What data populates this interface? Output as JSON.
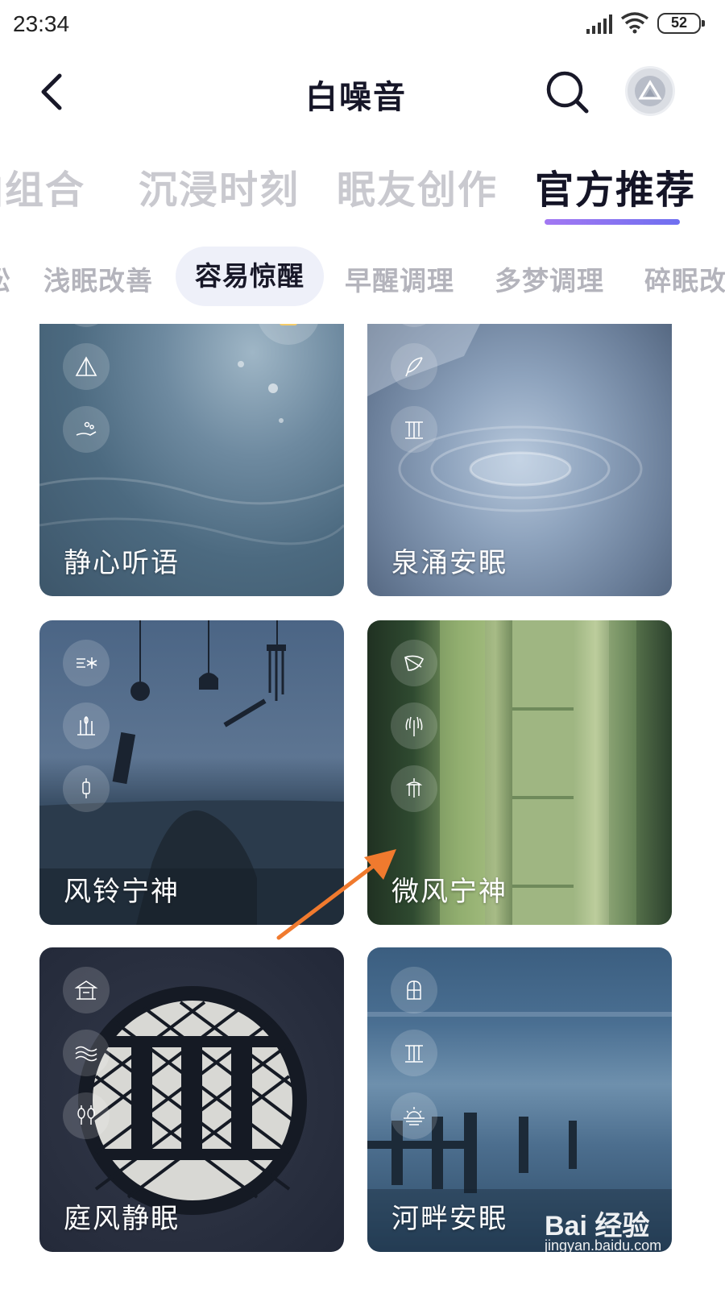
{
  "status": {
    "time": "23:34",
    "battery": "52"
  },
  "header": {
    "title": "白噪音"
  },
  "category_tabs": [
    "拍组合",
    "沉浸时刻",
    "眠友创作",
    "官方推荐"
  ],
  "sub_tabs": [
    "松",
    "浅眠改善",
    "容易惊醒",
    "早醒调理",
    "多梦调理",
    "碎眠改"
  ],
  "cards": [
    {
      "title": "静心听语",
      "icons": [
        "maple-leaf-icon",
        "tent-icon",
        "hand-sand-icon"
      ],
      "locked": true
    },
    {
      "title": "泉涌安眠",
      "icons": [
        "rain-icon",
        "feather-icon",
        "waterfall-icon"
      ],
      "locked": false
    },
    {
      "title": "风铃宁神",
      "icons": [
        "wind-snow-icon",
        "reeds-icon",
        "wind-chime-icon"
      ],
      "locked": false
    },
    {
      "title": "微风宁神",
      "icons": [
        "leaf-icon",
        "willow-icon",
        "wind-bell-icon"
      ],
      "locked": false
    },
    {
      "title": "庭风静眠",
      "icons": [
        "pavilion-icon",
        "waves-icon",
        "lanterns-icon"
      ],
      "locked": false
    },
    {
      "title": "河畔安眠",
      "icons": [
        "window-icon",
        "waterfall-icon",
        "sunset-icon"
      ],
      "locked": false
    }
  ],
  "watermark": {
    "logo": "Bai 经验",
    "url": "jingyan.baidu.com"
  },
  "colors": {
    "accent_start": "#a378f2",
    "accent_end": "#6f6ff0",
    "active_chip": "#eef0f9",
    "annotation_arrow": "#f07a2e"
  }
}
